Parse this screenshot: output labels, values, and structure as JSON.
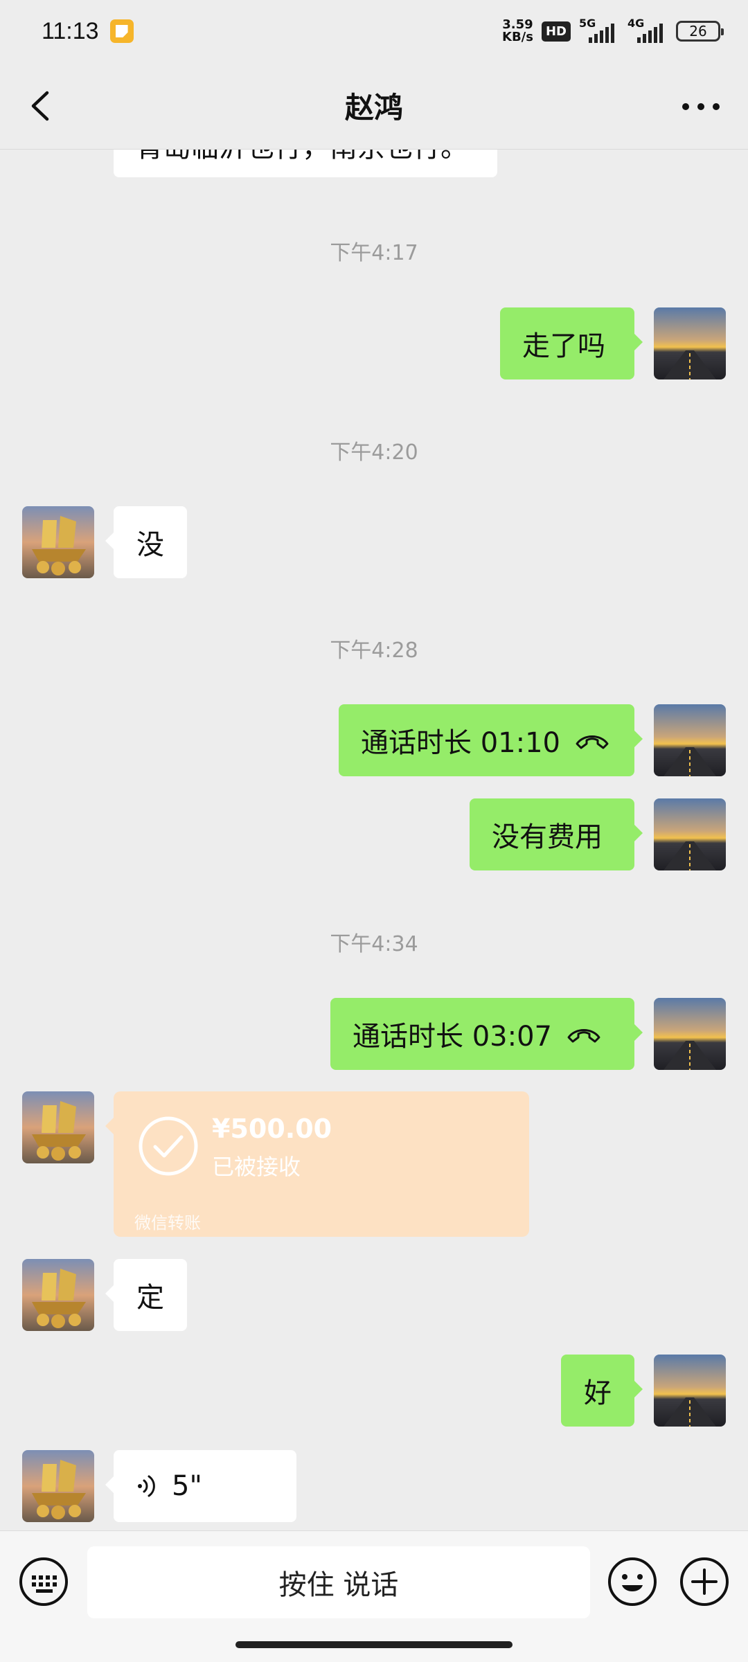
{
  "status_bar": {
    "time": "11:13",
    "net_speed_value": "3.59",
    "net_speed_unit": "KB/s",
    "hd_label": "HD",
    "signal1_label": "5G",
    "signal2_label": "4G",
    "battery": "26"
  },
  "header": {
    "title": "赵鸿",
    "back_icon": "chevron-left-icon",
    "more_icon": "more-dots-icon"
  },
  "messages": {
    "partial_top_text": "青岛临沂也行，南京也行。",
    "ts1": "下午4:17",
    "m1": "走了吗",
    "ts2": "下午4:20",
    "m2": "没",
    "ts3": "下午4:28",
    "m3": "通话时长 01:10",
    "m4": "没有费用",
    "ts4": "下午4:34",
    "m5": "通话时长 03:07",
    "transfer_amount": "¥500.00",
    "transfer_status": "已被接收",
    "transfer_footer": "微信转账",
    "m6": "定",
    "m7": "好",
    "voice_duration": "5\""
  },
  "input_bar": {
    "hold_to_talk": "按住 说话",
    "keyboard_icon": "keyboard-icon",
    "emoji_icon": "emoji-icon",
    "plus_icon": "plus-icon"
  },
  "colors": {
    "background": "#ededed",
    "outgoing_bubble": "#95ec69",
    "incoming_bubble": "#ffffff",
    "transfer_card": "#fde1c3"
  }
}
